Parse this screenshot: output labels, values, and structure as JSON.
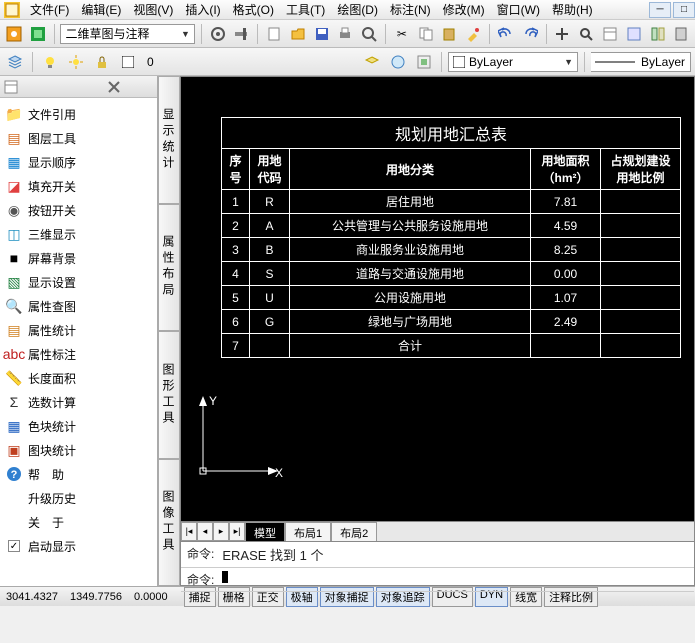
{
  "menu": {
    "items": [
      "文件(F)",
      "编辑(E)",
      "视图(V)",
      "插入(I)",
      "格式(O)",
      "工具(T)",
      "绘图(D)",
      "标注(N)",
      "修改(M)",
      "窗口(W)",
      "帮助(H)"
    ]
  },
  "workspace_combo": "二维草图与注释",
  "layer_value": "0",
  "bylayer": "ByLayer",
  "bylayer2": "ByLayer",
  "sidebar": {
    "items": [
      {
        "label": "文件引用",
        "icon": "📁",
        "color": "#d8a800"
      },
      {
        "label": "图层工具",
        "icon": "▤",
        "color": "#d2691e"
      },
      {
        "label": "显示顺序",
        "icon": "▦",
        "color": "#1080d0"
      },
      {
        "label": "填充开关",
        "icon": "◪",
        "color": "#e04040"
      },
      {
        "label": "按钮开关",
        "icon": "◉",
        "color": "#555"
      },
      {
        "label": "三维显示",
        "icon": "◫",
        "color": "#2090c0"
      },
      {
        "label": "屏幕背景",
        "icon": "■",
        "color": "#000"
      },
      {
        "label": "显示设置",
        "icon": "▧",
        "color": "#208040"
      },
      {
        "label": "属性查图",
        "icon": "🔍",
        "color": "#444"
      },
      {
        "label": "属性统计",
        "icon": "▤",
        "color": "#d08020"
      },
      {
        "label": "属性标注",
        "icon": "abc",
        "color": "#c02020"
      },
      {
        "label": "长度面积",
        "icon": "📏",
        "color": "#d8a800"
      },
      {
        "label": "选数计算",
        "icon": "Σ",
        "color": "#333"
      },
      {
        "label": "色块统计",
        "icon": "▦",
        "color": "#2060c0"
      },
      {
        "label": "图块统计",
        "icon": "▣",
        "color": "#c04020"
      },
      {
        "label": "帮　助",
        "icon": "?",
        "color": "#2060c0"
      },
      {
        "label": "升级历史",
        "icon": "",
        "color": "#333"
      },
      {
        "label": "关　于",
        "icon": "",
        "color": "#333"
      },
      {
        "label": "启动显示",
        "icon": "",
        "color": "#333",
        "checked": true
      }
    ]
  },
  "vtabs": [
    "显示统计",
    "属性布局",
    "图形工具",
    "图像工具"
  ],
  "table": {
    "title": "规划用地汇总表",
    "headers": [
      "序号",
      "用地代码",
      "用地分类",
      "用地面积（hm²）",
      "占规划建设用地比例"
    ],
    "rows": [
      [
        "1",
        "R",
        "居住用地",
        "7.81",
        ""
      ],
      [
        "2",
        "A",
        "公共管理与公共服务设施用地",
        "4.59",
        ""
      ],
      [
        "3",
        "B",
        "商业服务业设施用地",
        "8.25",
        ""
      ],
      [
        "4",
        "S",
        "道路与交通设施用地",
        "0.00",
        ""
      ],
      [
        "5",
        "U",
        "公用设施用地",
        "1.07",
        ""
      ],
      [
        "6",
        "G",
        "绿地与广场用地",
        "2.49",
        ""
      ],
      [
        "7",
        "",
        "合计",
        "",
        ""
      ]
    ]
  },
  "axis": {
    "x": "X",
    "y": "Y"
  },
  "doc_tabs": [
    "模型",
    "布局1",
    "布局2"
  ],
  "cmd": {
    "prompt": "命令:",
    "line1": "ERASE 找到 1 个",
    "line2": ""
  },
  "status": {
    "coords": [
      "3041.4327",
      "1349.7756",
      "0.0000"
    ],
    "toggles": [
      "捕捉",
      "栅格",
      "正交",
      "极轴",
      "对象捕捉",
      "对象追踪",
      "DUCS",
      "DYN",
      "线宽",
      "注释比例"
    ]
  },
  "chart_data": {
    "type": "table",
    "title": "规划用地汇总表",
    "columns": [
      "序号",
      "用地代码",
      "用地分类",
      "用地面积（hm²）",
      "占规划建设用地比例"
    ],
    "rows": [
      {
        "序号": 1,
        "用地代码": "R",
        "用地分类": "居住用地",
        "用地面积": 7.81
      },
      {
        "序号": 2,
        "用地代码": "A",
        "用地分类": "公共管理与公共服务设施用地",
        "用地面积": 4.59
      },
      {
        "序号": 3,
        "用地代码": "B",
        "用地分类": "商业服务业设施用地",
        "用地面积": 8.25
      },
      {
        "序号": 4,
        "用地代码": "S",
        "用地分类": "道路与交通设施用地",
        "用地面积": 0.0
      },
      {
        "序号": 5,
        "用地代码": "U",
        "用地分类": "公用设施用地",
        "用地面积": 1.07
      },
      {
        "序号": 6,
        "用地代码": "G",
        "用地分类": "绿地与广场用地",
        "用地面积": 2.49
      },
      {
        "序号": 7,
        "用地代码": "",
        "用地分类": "合计",
        "用地面积": null
      }
    ]
  }
}
